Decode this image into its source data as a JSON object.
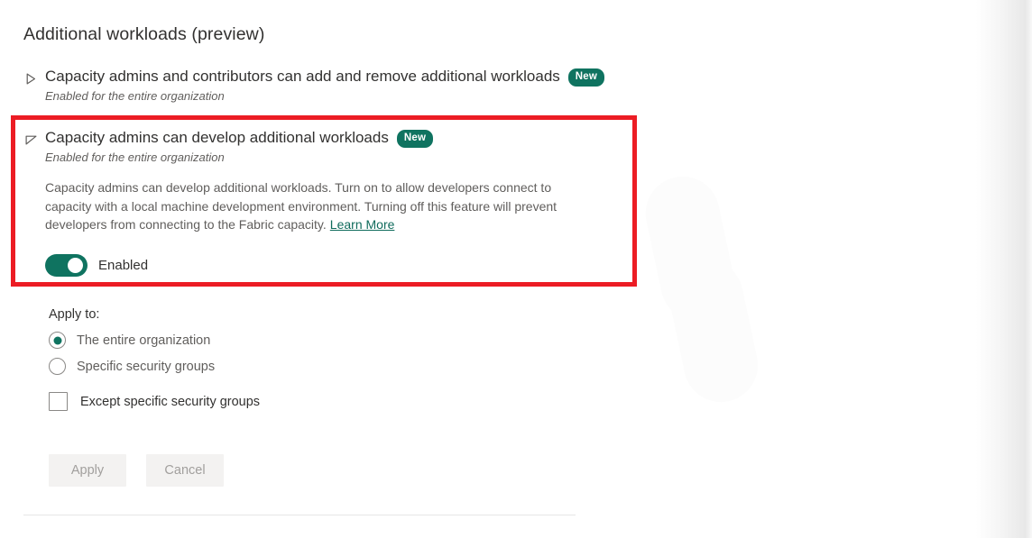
{
  "page": {
    "title": "Additional workloads (preview)"
  },
  "settings": [
    {
      "id": "add-remove-workloads",
      "chevron_icon": "chevron-right-icon",
      "title": "Capacity admins and contributors can add and remove additional workloads",
      "badge": "New",
      "subtitle": "Enabled for the entire organization",
      "expanded": false
    },
    {
      "id": "develop-workloads",
      "chevron_icon": "chevron-down-icon",
      "title": "Capacity admins can develop additional workloads",
      "badge": "New",
      "subtitle": "Enabled for the entire organization",
      "expanded": true,
      "description": "Capacity admins can develop additional workloads. Turn on to allow developers connect to capacity with a local machine development environment. Turning off this feature will prevent developers from connecting to the Fabric capacity.",
      "learn_more_label": "Learn More",
      "toggle": {
        "label": "Enabled",
        "state": "on"
      }
    }
  ],
  "apply_to": {
    "label": "Apply to:",
    "options": [
      {
        "label": "The entire organization",
        "selected": true
      },
      {
        "label": "Specific security groups",
        "selected": false
      }
    ],
    "except_checkbox": {
      "label": "Except specific security groups",
      "checked": false
    }
  },
  "actions": {
    "apply_label": "Apply",
    "cancel_label": "Cancel"
  },
  "colors": {
    "accent_green": "#0f7360",
    "link_teal": "#0f6b5c",
    "highlight_red": "#ec1c24",
    "badge_bg": "#0f7360",
    "button_bg": "#f3f2f1",
    "button_text": "#a19f9d",
    "text_primary": "#323130",
    "text_secondary": "#605e5c"
  }
}
